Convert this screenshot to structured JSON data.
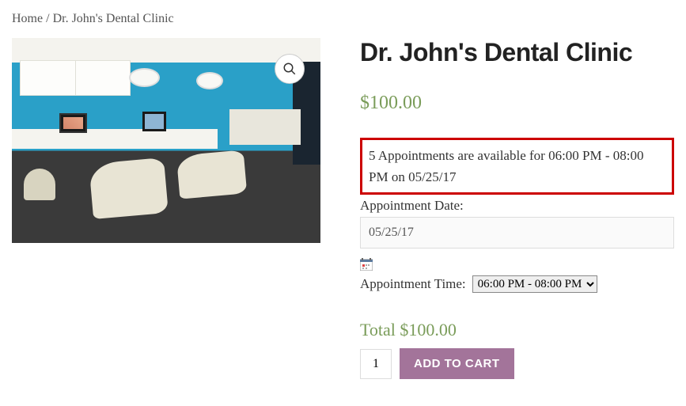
{
  "breadcrumb": {
    "home": "Home",
    "sep": " / ",
    "current": "Dr. John's Dental Clinic"
  },
  "product": {
    "title": "Dr. John's Dental Clinic",
    "price": "$100.00"
  },
  "availability_message": "5 Appointments are available for 06:00 PM - 08:00 PM on 05/25/17",
  "date": {
    "label": "Appointment Date:",
    "value": "05/25/17"
  },
  "time": {
    "label": "Appointment Time:",
    "selected": "06:00 PM - 08:00 PM"
  },
  "total": {
    "label": "Total ",
    "value": "$100.00"
  },
  "cart": {
    "qty": "1",
    "button": "ADD TO CART"
  },
  "icons": {
    "zoom": "search-icon",
    "calendar": "calendar-icon"
  }
}
